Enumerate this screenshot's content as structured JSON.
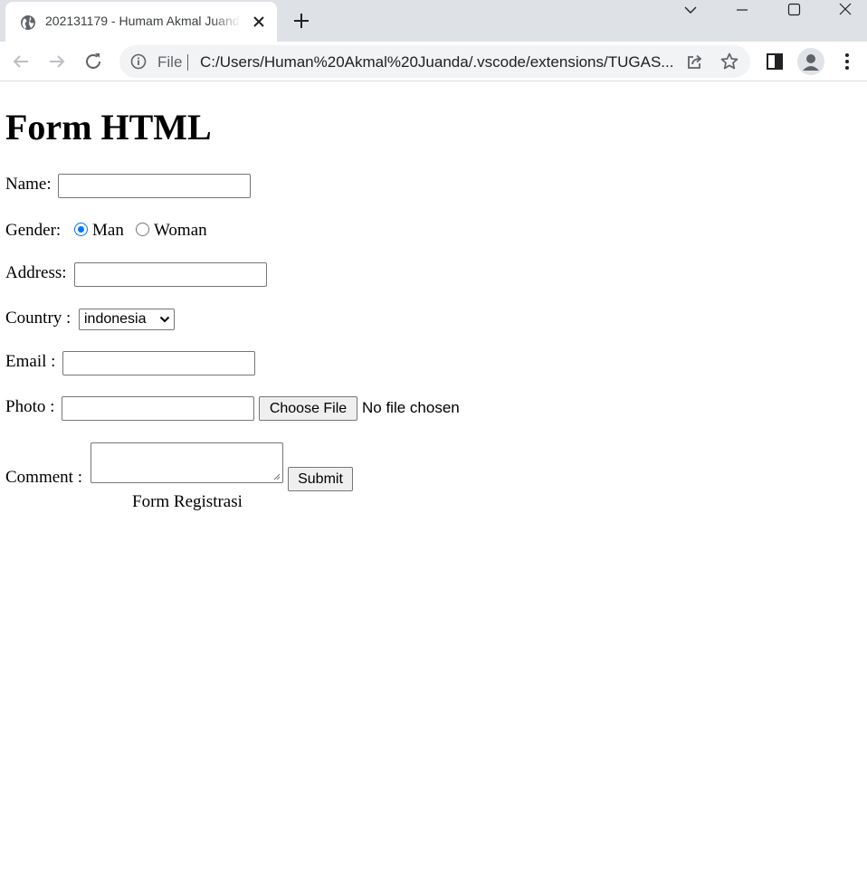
{
  "browser": {
    "tab_title": "202131179 - Humam Akmal Juanda",
    "address_scheme": "File",
    "address_url": "C:/Users/Human%20Akmal%20Juanda/.vscode/extensions/TUGAS..."
  },
  "form": {
    "heading": "Form HTML",
    "name_label": "Name:",
    "name_value": "",
    "gender_label": "Gender:",
    "gender_options": [
      {
        "label": "Man",
        "checked": true
      },
      {
        "label": "Woman",
        "checked": false
      }
    ],
    "address_label": "Address:",
    "address_value": "",
    "country_label": "Country :",
    "country_selected": "indonesia",
    "email_label": "Email :",
    "email_value": "",
    "photo_label": "Photo :",
    "photo_value": "",
    "choose_file_label": "Choose File",
    "no_file_text": "No file chosen",
    "comment_label": "Comment :",
    "comment_value": "",
    "submit_label": "Submit",
    "caption": "Form Registrasi"
  },
  "colors": {
    "tabstrip_bg": "#dee1e6",
    "omnibox_bg": "#f1f3f4",
    "radio_accent": "#0075ff",
    "button_bg": "#efefef"
  }
}
